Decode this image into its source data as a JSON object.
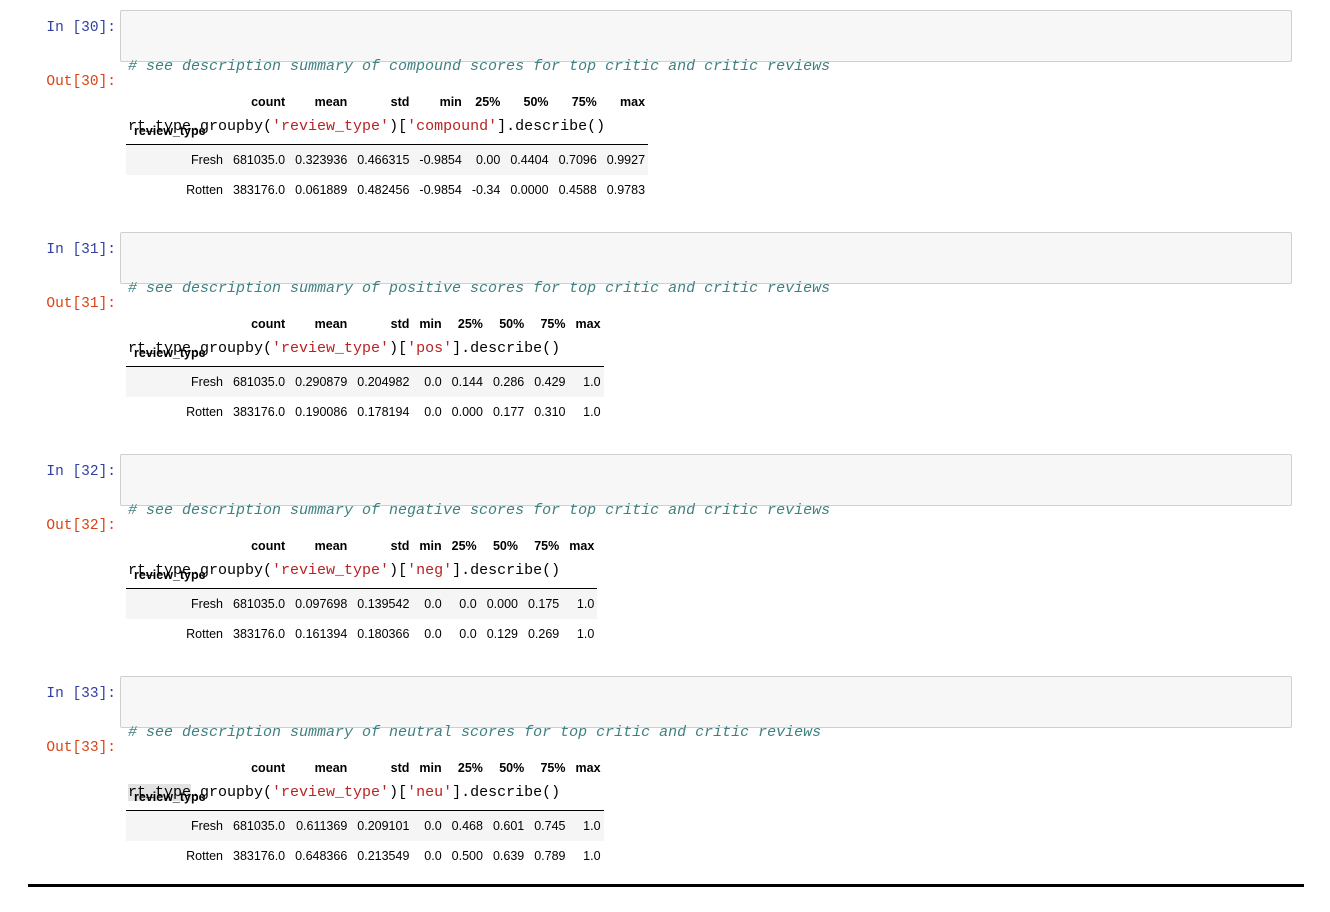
{
  "cells": [
    {
      "in_prompt": "In [30]:",
      "out_prompt": "Out[30]:",
      "comment": "# see description summary of compound scores for top critic and critic reviews",
      "code": {
        "var": "rt_type",
        "pre": ".groupby(",
        "arg1": "'review_type'",
        "mid": ")[",
        "arg2": "'compound'",
        "post": "].describe()"
      },
      "table": {
        "index_name": "review_type",
        "columns": [
          "count",
          "mean",
          "std",
          "min",
          "25%",
          "50%",
          "75%",
          "max"
        ],
        "rows": [
          [
            "Fresh",
            "681035.0",
            "0.323936",
            "0.466315",
            "-0.9854",
            "0.00",
            "0.4404",
            "0.7096",
            "0.9927"
          ],
          [
            "Rotten",
            "383176.0",
            "0.061889",
            "0.482456",
            "-0.9854",
            "-0.34",
            "0.0000",
            "0.4588",
            "0.9783"
          ]
        ]
      }
    },
    {
      "in_prompt": "In [31]:",
      "out_prompt": "Out[31]:",
      "comment": "# see description summary of positive scores for top critic and critic reviews",
      "code": {
        "var": "rt_type",
        "pre": ".groupby(",
        "arg1": "'review_type'",
        "mid": ")[",
        "arg2": "'pos'",
        "post": "].describe()"
      },
      "table": {
        "index_name": "review_type",
        "columns": [
          "count",
          "mean",
          "std",
          "min",
          "25%",
          "50%",
          "75%",
          "max"
        ],
        "rows": [
          [
            "Fresh",
            "681035.0",
            "0.290879",
            "0.204982",
            "0.0",
            "0.144",
            "0.286",
            "0.429",
            "1.0"
          ],
          [
            "Rotten",
            "383176.0",
            "0.190086",
            "0.178194",
            "0.0",
            "0.000",
            "0.177",
            "0.310",
            "1.0"
          ]
        ]
      }
    },
    {
      "in_prompt": "In [32]:",
      "out_prompt": "Out[32]:",
      "comment": "# see description summary of negative scores for top critic and critic reviews",
      "code": {
        "var": "rt_type",
        "pre": ".groupby(",
        "arg1": "'review_type'",
        "mid": ")[",
        "arg2": "'neg'",
        "post": "].describe()"
      },
      "table": {
        "index_name": "review_type",
        "columns": [
          "count",
          "mean",
          "std",
          "min",
          "25%",
          "50%",
          "75%",
          "max"
        ],
        "rows": [
          [
            "Fresh",
            "681035.0",
            "0.097698",
            "0.139542",
            "0.0",
            "0.0",
            "0.000",
            "0.175",
            "1.0"
          ],
          [
            "Rotten",
            "383176.0",
            "0.161394",
            "0.180366",
            "0.0",
            "0.0",
            "0.129",
            "0.269",
            "1.0"
          ]
        ]
      }
    },
    {
      "in_prompt": "In [33]:",
      "out_prompt": "Out[33]:",
      "comment": "# see description summary of neutral scores for top critic and critic reviews",
      "code": {
        "var": "rt_type",
        "pre": ".groupby(",
        "arg1": "'review_type'",
        "mid": ")[",
        "arg2": "'neu'",
        "post": "].describe()"
      },
      "table": {
        "index_name": "review_type",
        "columns": [
          "count",
          "mean",
          "std",
          "min",
          "25%",
          "50%",
          "75%",
          "max"
        ],
        "rows": [
          [
            "Fresh",
            "681035.0",
            "0.611369",
            "0.209101",
            "0.0",
            "0.468",
            "0.601",
            "0.745",
            "1.0"
          ],
          [
            "Rotten",
            "383176.0",
            "0.648366",
            "0.213549",
            "0.0",
            "0.500",
            "0.639",
            "0.789",
            "1.0"
          ]
        ]
      }
    }
  ]
}
